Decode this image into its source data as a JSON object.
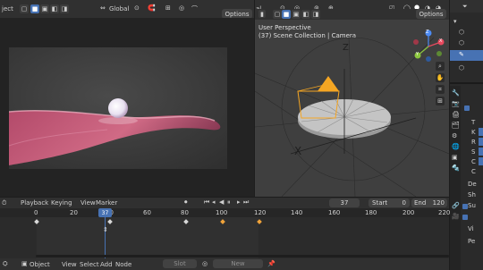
{
  "left_editor": {
    "header_text": "ject",
    "transform_orientation": "Global",
    "options_label": "Options"
  },
  "right_editor": {
    "header_text": "al",
    "options_label": "Options",
    "view_label": "User Perspective",
    "collection_label": "(37) Scene Collection | Camera",
    "gizmo_axes": {
      "x": "X",
      "y": "Y",
      "z": "Z"
    },
    "scene_labels": {
      "z": "Z",
      "x": "X"
    }
  },
  "timeline": {
    "menu": {
      "playback": "Playback",
      "keying": "Keying",
      "view": "View",
      "marker": "Marker"
    },
    "current_frame": "37",
    "start_label": "Start",
    "start_value": "0",
    "end_label": "End",
    "end_value": "120",
    "ruler_ticks": [
      "0",
      "20",
      "40",
      "60",
      "80",
      "100",
      "120",
      "140",
      "160",
      "180",
      "200",
      "220"
    ],
    "playhead_label": "37"
  },
  "node_bar": {
    "mode": "Object",
    "menu": {
      "view": "View",
      "select": "Select",
      "add": "Add",
      "node": "Node"
    },
    "slot_label": "Slot",
    "new_label": "New"
  },
  "outliner": {
    "side_labels": [
      "T",
      "K",
      "R",
      "S",
      "C",
      "C",
      "De",
      "Sh",
      "Su",
      "Vi",
      "Pe"
    ]
  },
  "colors": {
    "accent_blue": "#4772b3",
    "key_orange": "#f0a33a",
    "camera_orange": "#f5a623",
    "header_bg": "#303030",
    "viewport_bg": "#3f3f3f"
  }
}
